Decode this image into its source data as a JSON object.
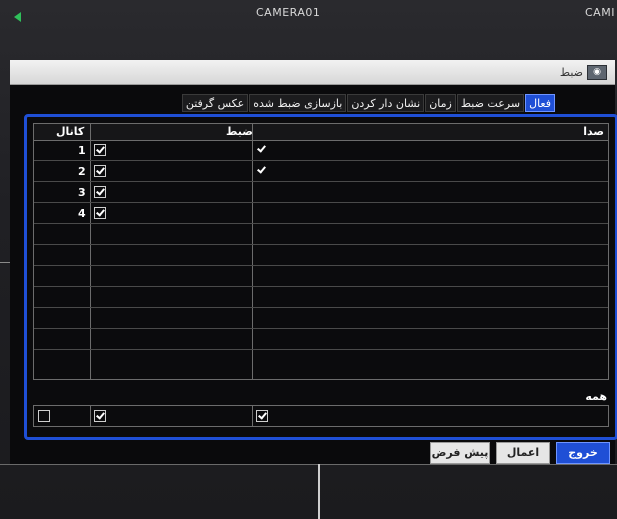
{
  "camera_overlay": {
    "title_1": "CAMERA01",
    "title_2": "CAMI"
  },
  "dialog": {
    "title": "ضبط",
    "title_icon": "record-icon"
  },
  "tabs": [
    {
      "label": "فعال",
      "active": true
    },
    {
      "label": "سرعت ضبط",
      "active": false
    },
    {
      "label": "زمان",
      "active": false
    },
    {
      "label": "نشان دار کردن",
      "active": false
    },
    {
      "label": "بازسازی ضبط شده",
      "active": false
    },
    {
      "label": "عکس گرفتن",
      "active": false
    }
  ],
  "table": {
    "headers": {
      "channel": "کانال",
      "record": "ضبط",
      "audio": "صدا"
    },
    "rows": [
      {
        "channel": "1",
        "record": true,
        "audio": true
      },
      {
        "channel": "2",
        "record": true,
        "audio": true
      },
      {
        "channel": "3",
        "record": true,
        "audio": false
      },
      {
        "channel": "4",
        "record": true,
        "audio": false
      }
    ],
    "all_label": "همه",
    "all_row": {
      "channel": false,
      "record": true,
      "audio": true
    }
  },
  "buttons": {
    "exit": "خروج",
    "apply": "اعمال",
    "default": "پیش فرض"
  },
  "colors": {
    "accent": "#1f4fd6",
    "background": "#0a0a0c"
  }
}
